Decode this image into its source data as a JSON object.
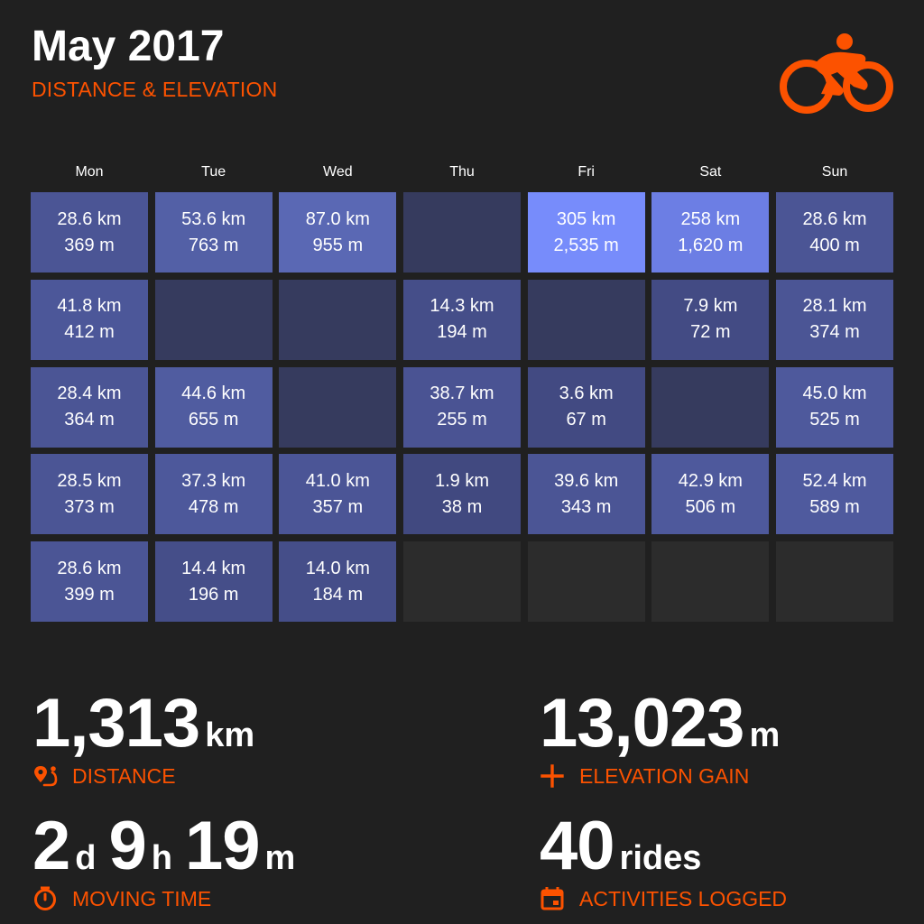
{
  "header": {
    "title": "May 2017",
    "subtitle": "DISTANCE & ELEVATION"
  },
  "colors": {
    "accent": "#fc5200",
    "background": "#202020",
    "cell_text": "#ffffff"
  },
  "calendar": {
    "days": [
      "Mon",
      "Tue",
      "Wed",
      "Thu",
      "Fri",
      "Sat",
      "Sun"
    ],
    "weeks": [
      [
        {
          "dist": "28.6 km",
          "elev": "369 m",
          "color": "#4b5595"
        },
        {
          "dist": "53.6 km",
          "elev": "763 m",
          "color": "#5360a6"
        },
        {
          "dist": "87.0 km",
          "elev": "955 m",
          "color": "#5a68b4"
        },
        {
          "dist": "",
          "elev": "",
          "color": "#363b5e"
        },
        {
          "dist": "305 km",
          "elev": "2,535 m",
          "color": "#778cfb"
        },
        {
          "dist": "258 km",
          "elev": "1,620 m",
          "color": "#6c7ee4"
        },
        {
          "dist": "28.6 km",
          "elev": "400 m",
          "color": "#4b5595"
        }
      ],
      [
        {
          "dist": "41.8 km",
          "elev": "412 m",
          "color": "#4c5799"
        },
        {
          "dist": "",
          "elev": "",
          "color": "#363b5e"
        },
        {
          "dist": "",
          "elev": "",
          "color": "#363b5e"
        },
        {
          "dist": "14.3 km",
          "elev": "194 m",
          "color": "#454e89"
        },
        {
          "dist": "",
          "elev": "",
          "color": "#363b5e"
        },
        {
          "dist": "7.9 km",
          "elev": "72 m",
          "color": "#434b84"
        },
        {
          "dist": "28.1 km",
          "elev": "374 m",
          "color": "#4b5595"
        }
      ],
      [
        {
          "dist": "28.4 km",
          "elev": "364 m",
          "color": "#4b5595"
        },
        {
          "dist": "44.6 km",
          "elev": "655 m",
          "color": "#505ca0"
        },
        {
          "dist": "",
          "elev": "",
          "color": "#363b5e"
        },
        {
          "dist": "38.7 km",
          "elev": "255 m",
          "color": "#4a5393"
        },
        {
          "dist": "3.6 km",
          "elev": "67 m",
          "color": "#424a82"
        },
        {
          "dist": "",
          "elev": "",
          "color": "#363b5e"
        },
        {
          "dist": "45.0 km",
          "elev": "525 m",
          "color": "#4e599c"
        }
      ],
      [
        {
          "dist": "28.5 km",
          "elev": "373 m",
          "color": "#4b5595"
        },
        {
          "dist": "37.3 km",
          "elev": "478 m",
          "color": "#4d589b"
        },
        {
          "dist": "41.0 km",
          "elev": "357 m",
          "color": "#4b5596"
        },
        {
          "dist": "1.9 km",
          "elev": "38 m",
          "color": "#414980"
        },
        {
          "dist": "39.6 km",
          "elev": "343 m",
          "color": "#4b5595"
        },
        {
          "dist": "42.9 km",
          "elev": "506 m",
          "color": "#4e599c"
        },
        {
          "dist": "52.4 km",
          "elev": "589 m",
          "color": "#4f5a9e"
        }
      ],
      [
        {
          "dist": "28.6 km",
          "elev": "399 m",
          "color": "#4b5595"
        },
        {
          "dist": "14.4 km",
          "elev": "196 m",
          "color": "#454e89"
        },
        {
          "dist": "14.0 km",
          "elev": "184 m",
          "color": "#454e89"
        },
        {
          "dist": "",
          "elev": "",
          "color": "#2c2c2c"
        },
        {
          "dist": "",
          "elev": "",
          "color": "#2c2c2c"
        },
        {
          "dist": "",
          "elev": "",
          "color": "#2c2c2c"
        },
        {
          "dist": "",
          "elev": "",
          "color": "#2c2c2c"
        }
      ]
    ]
  },
  "stats": {
    "distance": {
      "value": "1,313",
      "unit": "km",
      "label": "DISTANCE",
      "icon": "route-pin-icon"
    },
    "elevation": {
      "value": "13,023",
      "unit": "m",
      "label": "ELEVATION GAIN",
      "icon": "plus-icon"
    },
    "moving_time": {
      "days": "2",
      "days_unit": "d",
      "hours": "9",
      "hours_unit": "h",
      "minutes": "19",
      "minutes_unit": "m",
      "label": "MOVING TIME",
      "icon": "stopwatch-icon"
    },
    "rides": {
      "value": "40",
      "unit": "rides",
      "label": "ACTIVITIES LOGGED",
      "icon": "calendar-icon"
    }
  }
}
